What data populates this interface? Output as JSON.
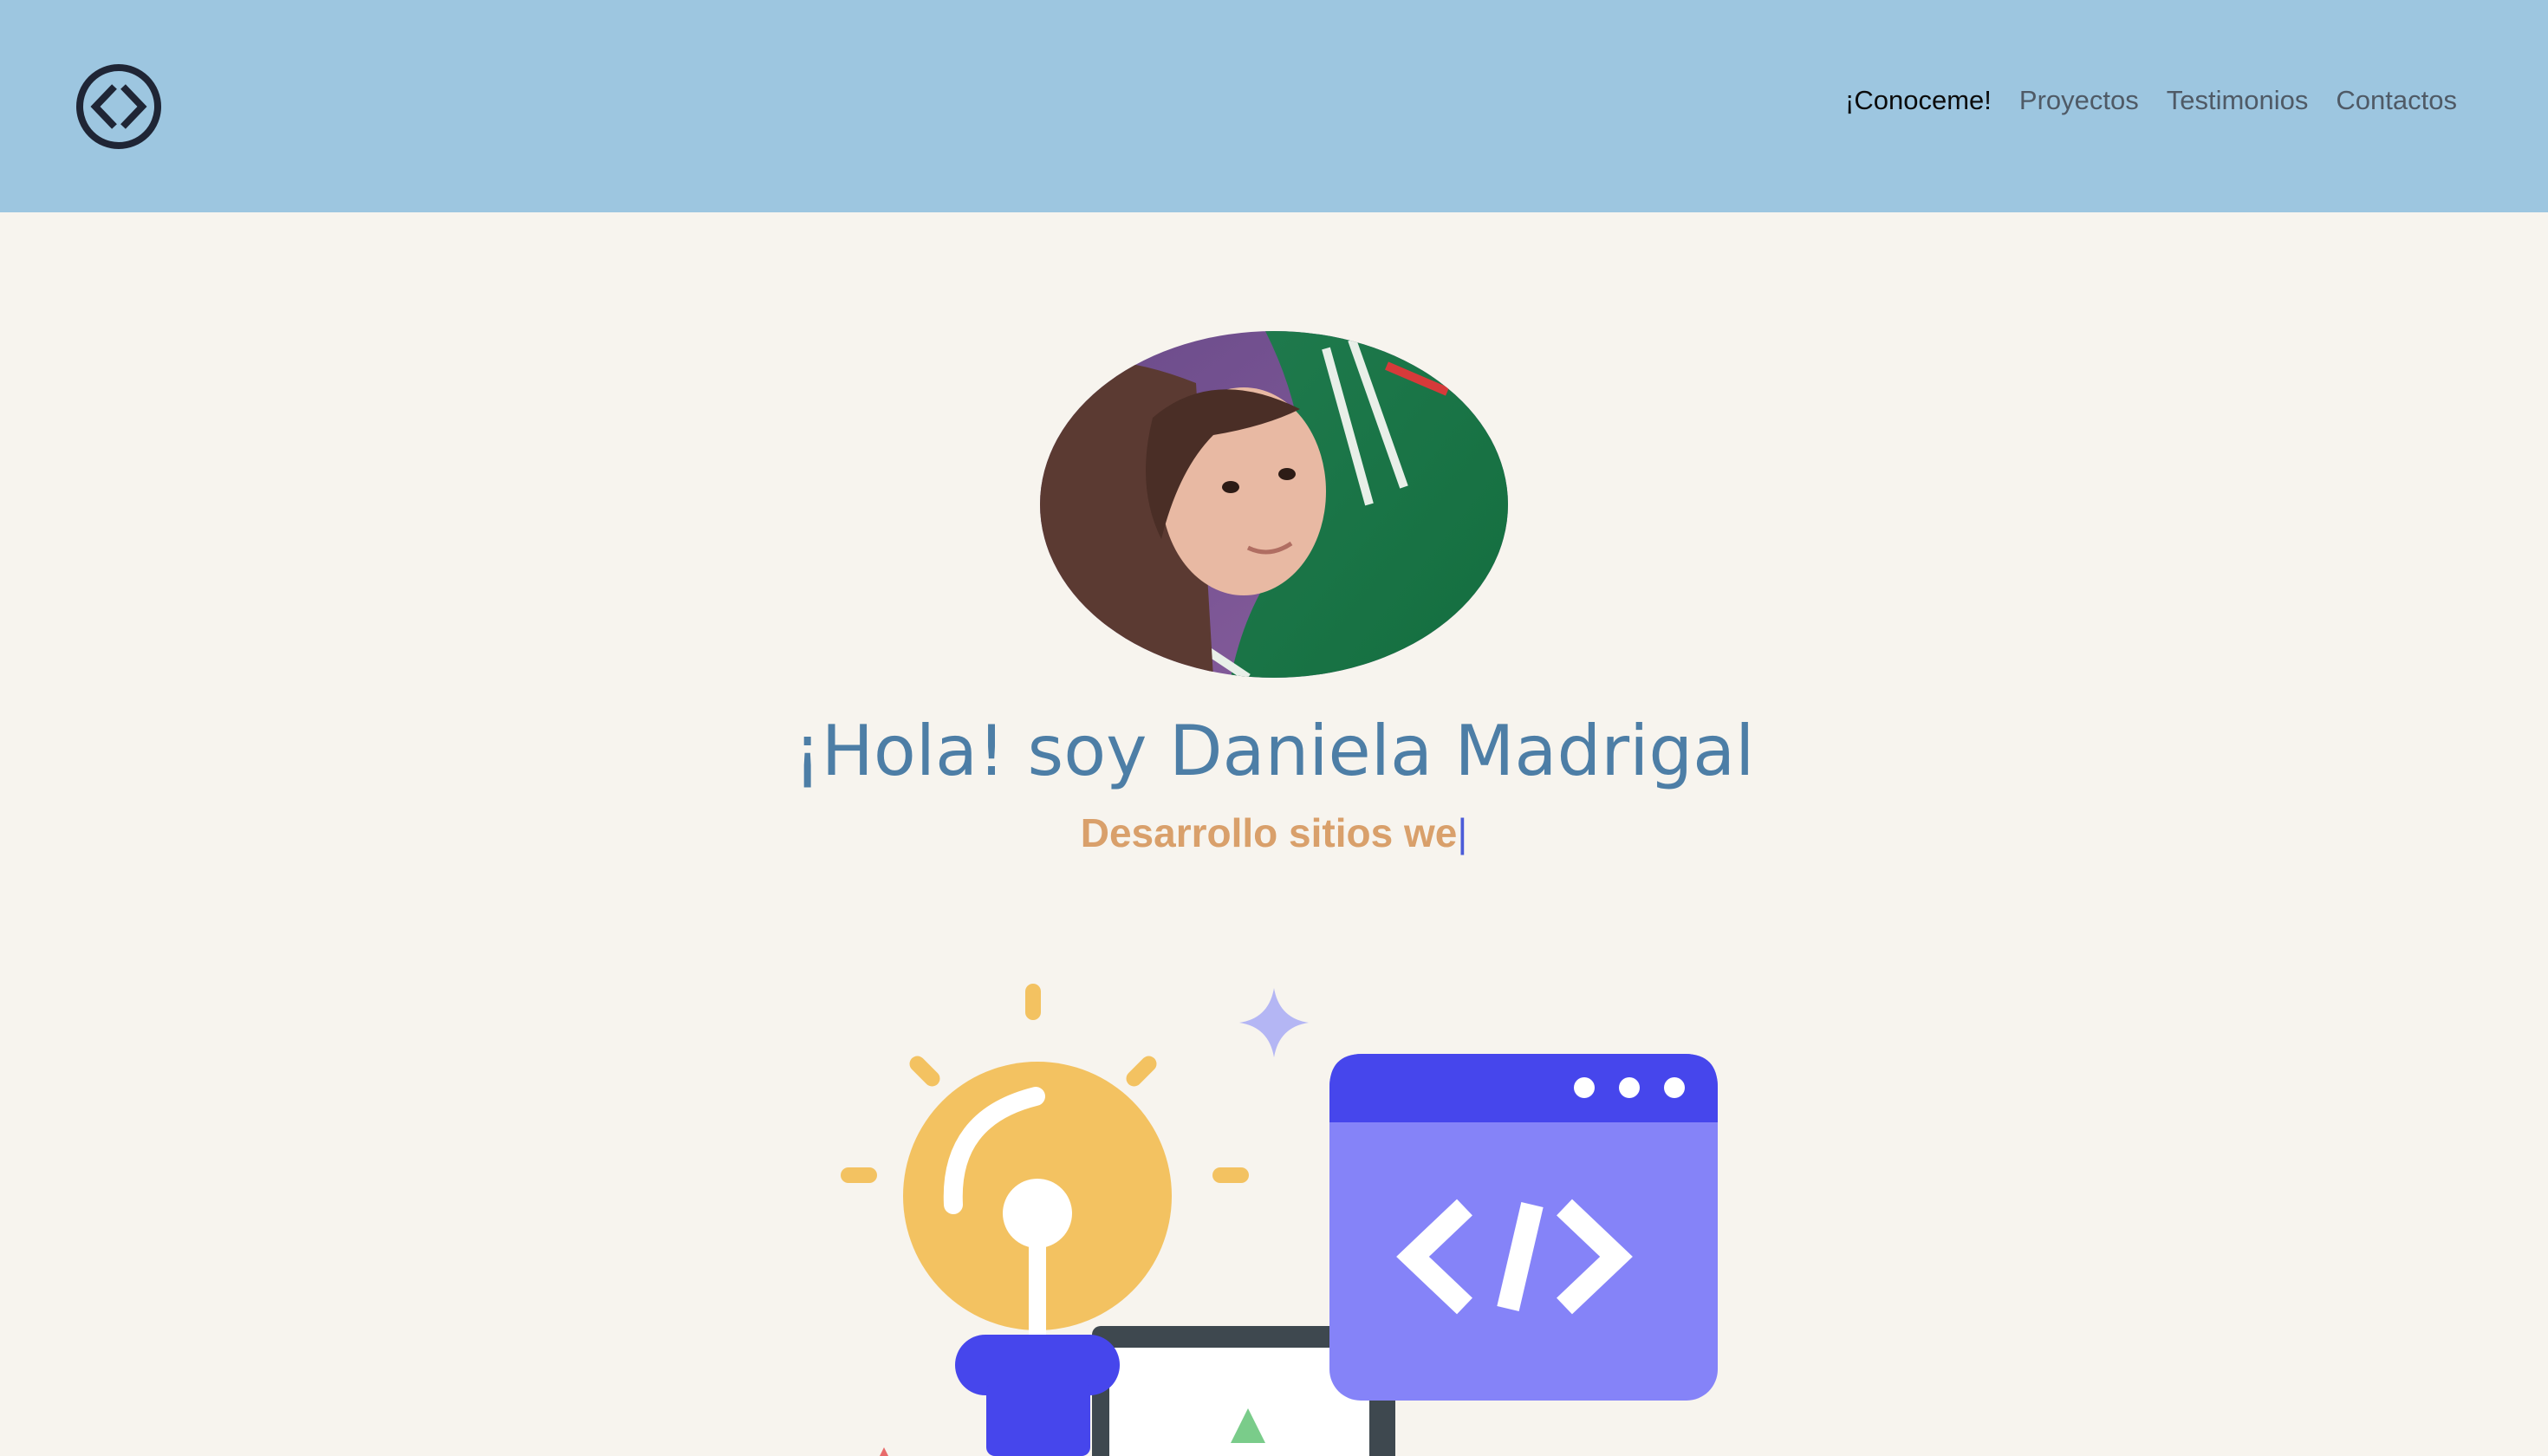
{
  "nav": {
    "links": [
      "¡Conoceme!",
      "Proyectos",
      "Testimonios",
      "Contactos"
    ]
  },
  "hero": {
    "title": "¡Hola! soy Daniela Madrigal",
    "subtitle": "Desarrollo sitios we",
    "cursor": "|"
  },
  "icons": {
    "logo": "code-brackets-circle-icon",
    "illustration": "lightbulb-code-window-illustration"
  },
  "colors": {
    "navbar": "#9dc6e0",
    "background": "#f7f4ee",
    "title": "#4d7ea6",
    "subtitle": "#d9a06b",
    "accent": "#4b48e8"
  }
}
